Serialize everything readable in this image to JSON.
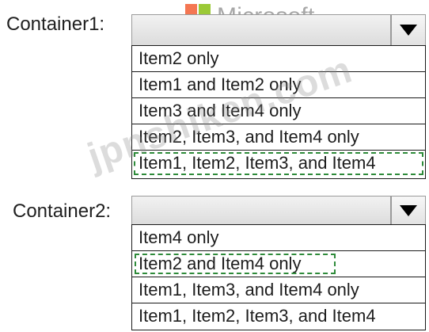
{
  "brand": {
    "logo_text": "Microsoft",
    "colors": [
      "#f25022",
      "#7fba00",
      "#00a4ef",
      "#ffb900"
    ]
  },
  "watermark": {
    "text": "jpnshiken.com"
  },
  "container1": {
    "label": "Container1:",
    "selected_value": "",
    "options": [
      "Item2 only",
      "Item1 and Item2 only",
      "Item3 and Item4 only",
      "Item2, Item3, and Item4 only",
      "Item1, Item2, Item3, and Item4"
    ],
    "highlighted_option": "Item1, Item2, Item3, and Item4"
  },
  "container2": {
    "label": "Container2:",
    "selected_value": "",
    "options": [
      "Item4 only",
      "Item2 and Item4 only",
      "Item1, Item3, and Item4 only",
      "Item1, Item2, Item3, and Item4"
    ],
    "highlighted_option": "Item2 and Item4 only"
  },
  "icons": {
    "dropdown": "chevron-down-icon"
  }
}
